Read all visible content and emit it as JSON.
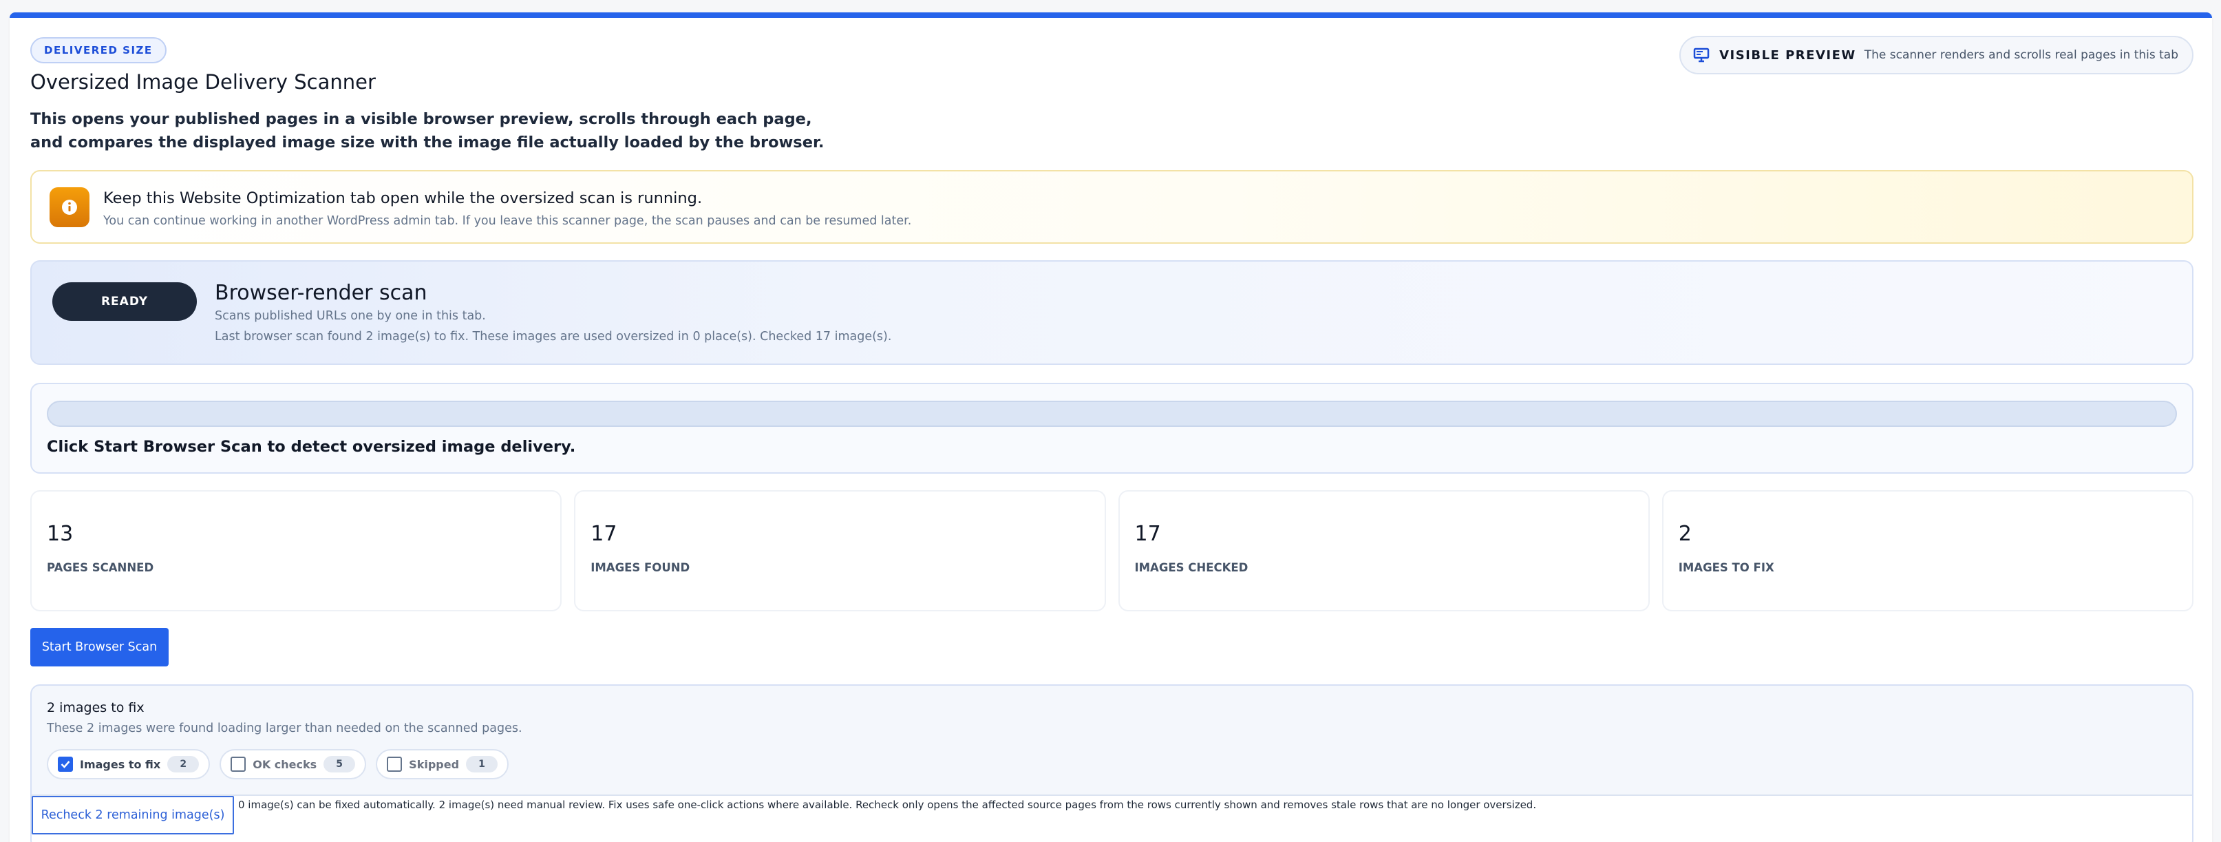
{
  "header": {
    "eyebrow": "DELIVERED SIZE",
    "title": "Oversized Image Delivery Scanner",
    "intro": "This opens your published pages in a visible browser preview, scrolls through each page, and compares the displayed image size with the image file actually loaded by the browser.",
    "preview_label": "VISIBLE PREVIEW",
    "preview_desc": "The scanner renders and scrolls real pages in this tab"
  },
  "notice": {
    "icon": "info-icon",
    "heading": "Keep this Website Optimization tab open while the oversized scan is running.",
    "text": "You can continue working in another WordPress admin tab. If you leave this scanner page, the scan pauses and can be resumed later."
  },
  "scan": {
    "status": "READY",
    "title": "Browser-render scan",
    "line1": "Scans published URLs one by one in this tab.",
    "line2": "Last browser scan found 2 image(s) to fix. These images are used oversized in 0 place(s). Checked 17 image(s)."
  },
  "progress": {
    "percent": 0,
    "message": "Click Start Browser Scan to detect oversized image delivery."
  },
  "stats": [
    {
      "value": "13",
      "label": "PAGES SCANNED"
    },
    {
      "value": "17",
      "label": "IMAGES FOUND"
    },
    {
      "value": "17",
      "label": "IMAGES CHECKED"
    },
    {
      "value": "2",
      "label": "IMAGES TO FIX"
    }
  ],
  "actions": {
    "start_label": "Start Browser Scan"
  },
  "results": {
    "heading": "2 images to fix",
    "subtext": "These 2 images were found loading larger than needed on the scanned pages.",
    "filters": [
      {
        "label": "Images to fix",
        "count": "2",
        "checked": true
      },
      {
        "label": "OK checks",
        "count": "5",
        "checked": false
      },
      {
        "label": "Skipped",
        "count": "1",
        "checked": false
      }
    ],
    "recheck_label": "Recheck 2 remaining image(s)",
    "note": "0 image(s) can be fixed automatically. 2 image(s) need manual review. Fix uses safe one-click actions where available. Recheck only opens the affected source pages from the rows currently shown and removes stale rows that are no longer oversized."
  },
  "colors": {
    "accent": "#2563eb",
    "dark": "#1e293b",
    "notice_badge": "#d97706"
  }
}
